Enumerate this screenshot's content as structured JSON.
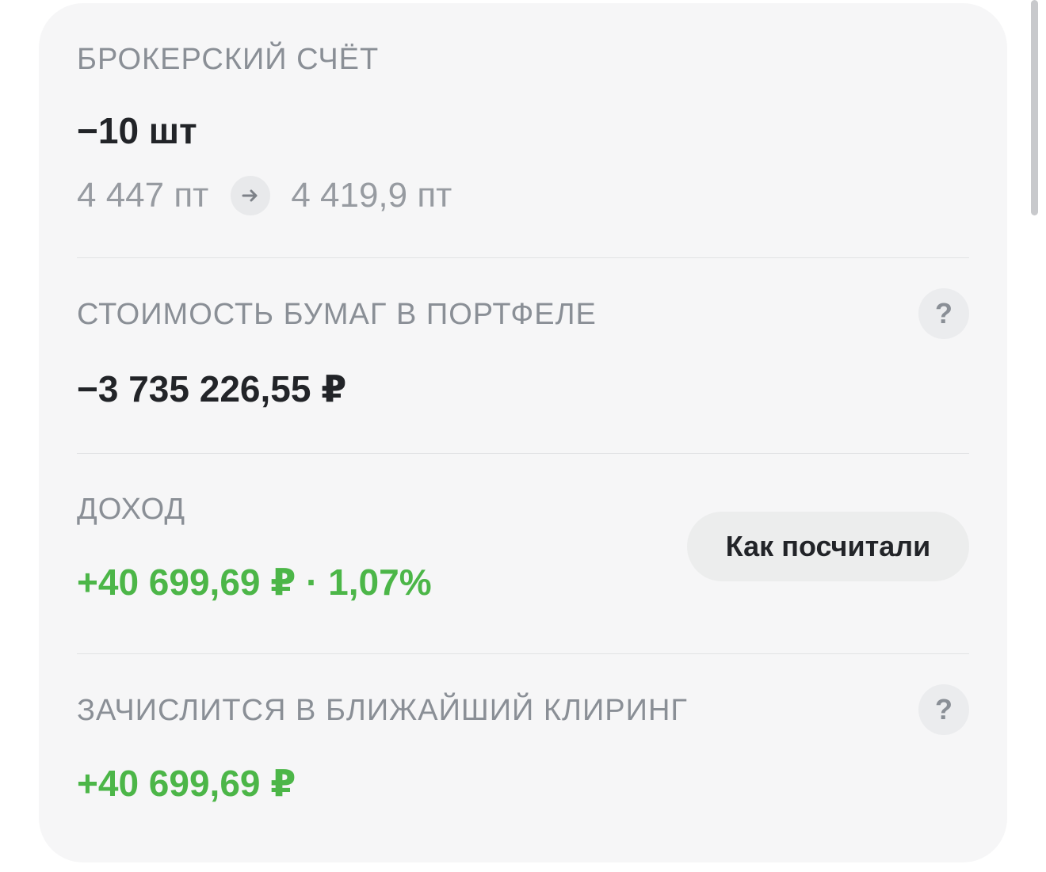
{
  "brokerage": {
    "label": "БРОКЕРСКИЙ СЧЁТ",
    "quantity": "−10 шт",
    "price_from": "4 447 пт",
    "price_to": "4 419,9 пт"
  },
  "portfolio_value": {
    "label": "СТОИМОСТЬ БУМАГ В ПОРТФЕЛЕ",
    "value": "−3 735 226,55 ₽",
    "help": "?"
  },
  "income": {
    "label": "ДОХОД",
    "value": "+40 699,69 ₽ · 1,07%",
    "button_label": "Как посчитали"
  },
  "clearing": {
    "label": "ЗАЧИСЛИТСЯ В БЛИЖАЙШИЙ КЛИРИНГ",
    "value": "+40 699,69 ₽",
    "help": "?"
  },
  "colors": {
    "positive": "#4cb648",
    "label": "#8a8f96",
    "card_bg": "#f6f6f7"
  },
  "icons": {
    "arrow": "arrow-right-icon",
    "help": "question-icon"
  }
}
